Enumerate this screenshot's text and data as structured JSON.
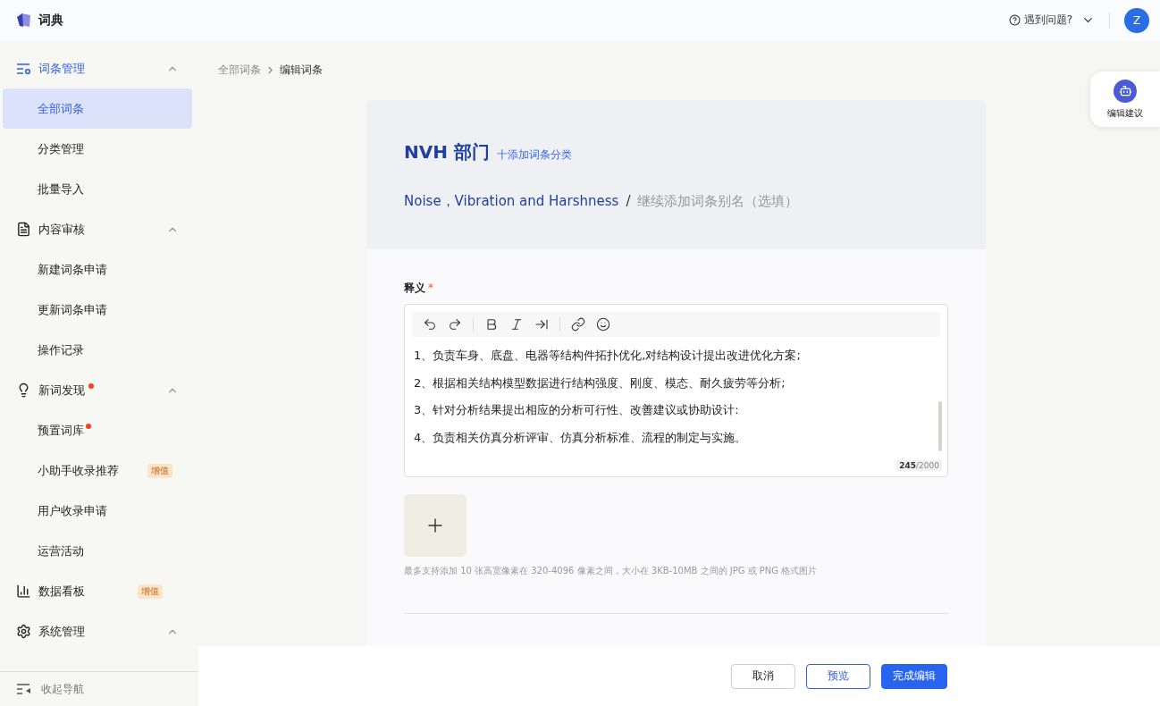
{
  "app": {
    "name": "词典"
  },
  "header": {
    "help": "遇到问题?",
    "avatar": "Z"
  },
  "sidebar": {
    "groups": [
      {
        "label": "词条管理",
        "active": true,
        "expanded": true,
        "children": [
          {
            "label": "全部词条",
            "selected": true
          },
          {
            "label": "分类管理",
            "selected": false
          },
          {
            "label": "批量导入",
            "selected": false
          }
        ]
      },
      {
        "label": "内容审核",
        "active": false,
        "expanded": true,
        "children": [
          {
            "label": "新建词条申请",
            "selected": false
          },
          {
            "label": "更新词条申请",
            "selected": false
          },
          {
            "label": "操作记录",
            "selected": false
          }
        ]
      },
      {
        "label": "新词发现",
        "active": false,
        "expanded": true,
        "dot": true,
        "children": [
          {
            "label": "预置词库",
            "selected": false,
            "dot": true
          },
          {
            "label": "小助手收录推荐",
            "selected": false,
            "badge": "增值"
          },
          {
            "label": "用户收录申请",
            "selected": false
          },
          {
            "label": "运营活动",
            "selected": false
          }
        ]
      },
      {
        "label": "数据看板",
        "active": false,
        "badge": "增值"
      },
      {
        "label": "系统管理",
        "active": false,
        "expanded": true
      }
    ],
    "collapse": "收起导航"
  },
  "breadcrumb": [
    "全部词条",
    "编辑词条"
  ],
  "entry": {
    "title": "NVH 部门",
    "add_category": "十添加词条分类",
    "alias": "Noise，Vibration and Harshness",
    "alias_separator": "/",
    "alias_placeholder": "继续添加词条别名（选填）"
  },
  "definition": {
    "label": "释义",
    "required_mark": "*",
    "lines": [
      "1、负责车身、底盘、电器等结构件拓扑优化,对结构设计提出改进优化方案;",
      "2、根据相关结构模型数据进行结构强度、刚度、模态、耐久疲劳等分析;",
      "3、针对分析结果提出相应的分析可行性、改善建议或协助设计:",
      "4、负责相关仿真分析评审、仿真分析标准、流程的制定与实施。"
    ],
    "counter": "**245**/2000"
  },
  "upload": {
    "hint": "最多支持添加 10 张高宽像素在 320-4096 像素之间，大小在 3KB-10MB 之间的 JPG 或 PNG 格式图片"
  },
  "assistant": {
    "label": "编辑建议"
  },
  "footer": {
    "buttons": [
      {
        "label": "取消",
        "kind": "default"
      },
      {
        "label": "预览",
        "kind": "outline"
      },
      {
        "label": "完成编辑",
        "kind": "primary"
      }
    ]
  }
}
